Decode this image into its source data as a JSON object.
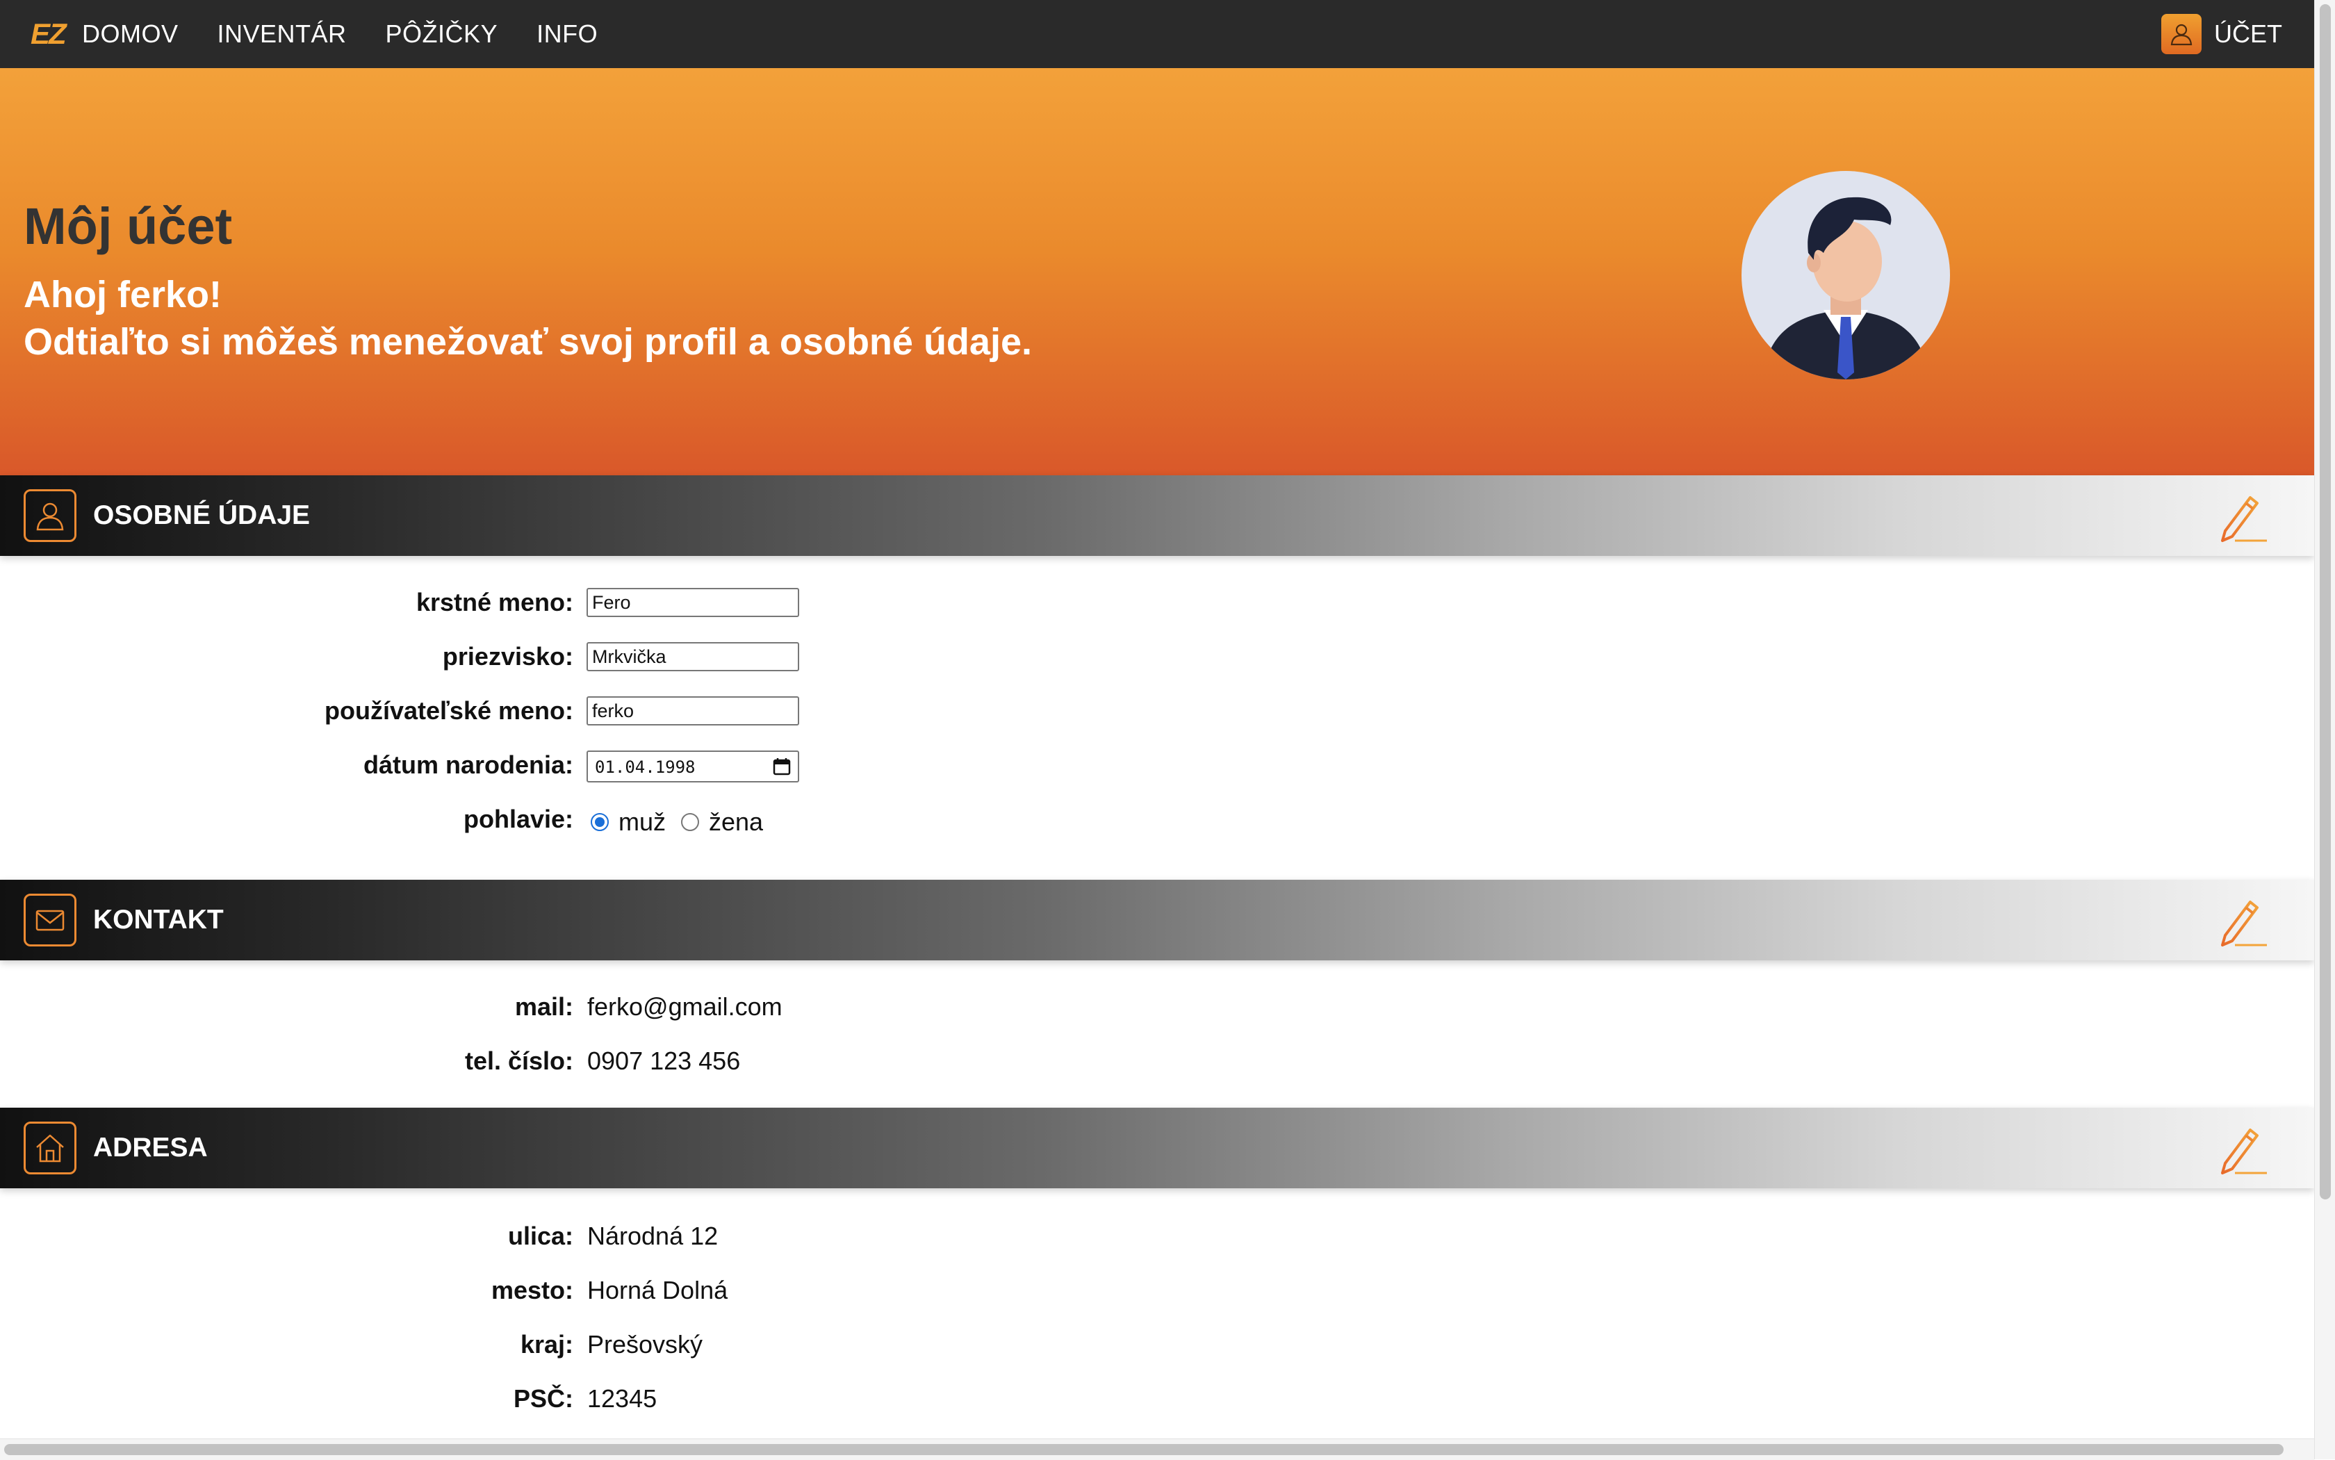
{
  "nav": {
    "logo": "EZ",
    "links": [
      "DOMOV",
      "INVENTÁR",
      "PÔŽIČKY",
      "INFO"
    ],
    "account_label": "ÚČET"
  },
  "hero": {
    "title": "Môj účet",
    "greeting": "Ahoj ferko!",
    "subtitle": "Odtiaľto si môžeš menežovať svoj profil a osobné údaje."
  },
  "personal": {
    "title": "OSOBNÉ ÚDAJE",
    "first_name_label": "krstné meno:",
    "first_name_value": "Fero",
    "last_name_label": "priezvisko:",
    "last_name_value": "Mrkvička",
    "username_label": "používateľské meno:",
    "username_value": "ferko",
    "birthdate_label": "dátum narodenia:",
    "birthdate_value": "01.04.1998",
    "gender_label": "pohlavie:",
    "gender_options": [
      "muž",
      "žena"
    ],
    "gender_selected": "muž"
  },
  "contact": {
    "title": "KONTAKT",
    "mail_label": "mail:",
    "mail_value": "ferko@gmail.com",
    "phone_label": "tel. číslo:",
    "phone_value": "0907 123 456"
  },
  "address": {
    "title": "ADRESA",
    "street_label": "ulica:",
    "street_value": "Národná 12",
    "city_label": "mesto:",
    "city_value": "Horná Dolná",
    "region_label": "kraj:",
    "region_value": "Prešovský",
    "zip_label": "PSČ:",
    "zip_value": "12345"
  },
  "colors": {
    "accent": "#ec8a32",
    "nav_bg": "#2a2a2a",
    "hero_top": "#f3a13a",
    "hero_bottom": "#d9582a",
    "radio_selected": "#1a6fd8"
  },
  "icons": {
    "account": "person-icon",
    "personal": "person-icon",
    "contact": "envelope-icon",
    "address": "house-icon",
    "edit": "pencil-icon",
    "date": "calendar-icon"
  }
}
